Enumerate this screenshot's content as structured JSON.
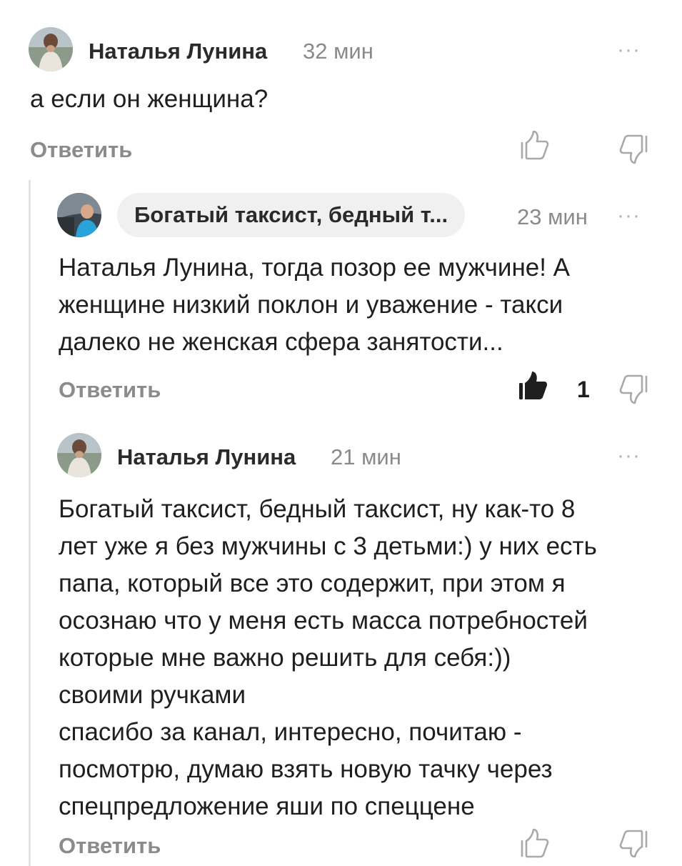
{
  "comments": [
    {
      "author": "Наталья Лунина",
      "time": "32 мин",
      "text": "а если он женщина?",
      "reply_label": "Ответить",
      "more": "···"
    },
    {
      "author": "Богатый таксист, бедный т...",
      "time": "23 мин",
      "text_lines": [
        "Наталья Лунина, тогда позор ее мужчине! А",
        "женщине низкий поклон и уважение - такси",
        "далеко не женская сфера занятости..."
      ],
      "reply_label": "Ответить",
      "like_count": "1",
      "more": "···"
    },
    {
      "author": "Наталья Лунина",
      "time": "21 мин",
      "text_lines": [
        "Богатый таксист, бедный таксист, ну как-то 8",
        "лет уже я без мужчины с 3 детьми:) у них есть",
        "папа, который все это содержит, при этом я",
        "осознаю что у меня есть масса потребностей",
        "которые мне важно решить для себя:))",
        "своими ручками",
        "спасибо за канал, интересно, почитаю -",
        "посмотрю, думаю взять новую тачку через",
        "спецпредложение яши по спеццене"
      ],
      "reply_label": "Ответить",
      "more": "···"
    }
  ],
  "colors": {
    "text": "#1f1f1f",
    "muted": "#8b8b8b",
    "pill": "#f0f0f1",
    "thread_line": "#e3e3e3"
  },
  "icons": [
    "avatar-photo",
    "like-icon",
    "dislike-icon",
    "more-icon"
  ]
}
